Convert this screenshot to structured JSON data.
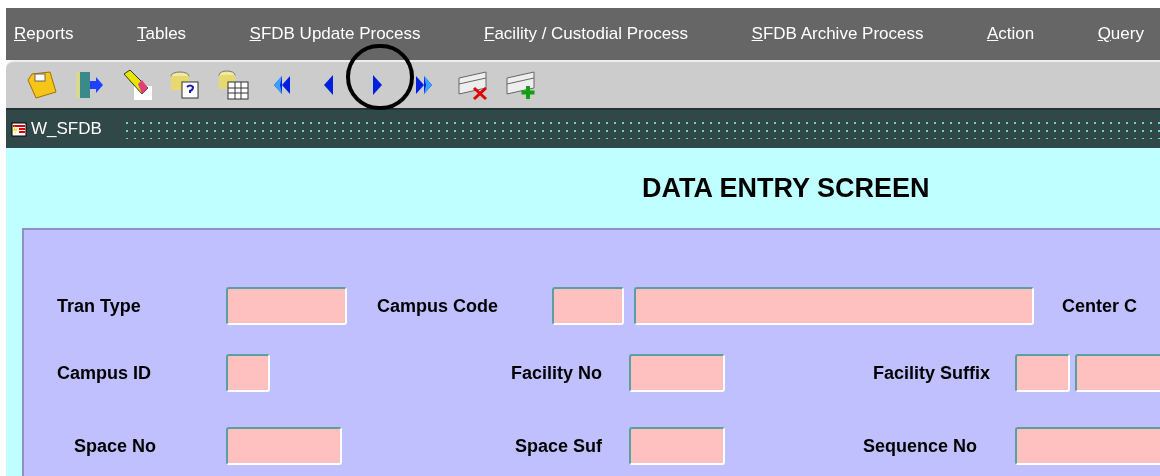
{
  "menu": [
    {
      "label": "Reports"
    },
    {
      "label": "Tables"
    },
    {
      "label": "SFDB Update Process"
    },
    {
      "label": "Facility / Custodial Process"
    },
    {
      "label": "SFDB Archive Process"
    },
    {
      "label": "Action"
    },
    {
      "label": "Query"
    }
  ],
  "window": {
    "title": "W_SFDB"
  },
  "form": {
    "heading": "DATA ENTRY SCREEN",
    "rows": [
      [
        {
          "kind": "label",
          "text": "Tran Type"
        },
        {
          "kind": "field"
        },
        {
          "kind": "label",
          "text": "Campus Code"
        },
        {
          "kind": "field"
        },
        {
          "kind": "field"
        },
        {
          "kind": "label",
          "text": "Center C"
        }
      ],
      [
        {
          "kind": "label",
          "text": "Campus ID"
        },
        {
          "kind": "field"
        },
        {
          "kind": "label",
          "text": "Facility No"
        },
        {
          "kind": "field"
        },
        {
          "kind": "label",
          "text": "Facility Suffix"
        },
        {
          "kind": "field"
        },
        {
          "kind": "field"
        }
      ],
      [
        {
          "kind": "label",
          "text": "Space No"
        },
        {
          "kind": "field"
        },
        {
          "kind": "label",
          "text": "Space Suf"
        },
        {
          "kind": "field"
        },
        {
          "kind": "label",
          "text": "Sequence No"
        },
        {
          "kind": "field"
        }
      ]
    ]
  }
}
